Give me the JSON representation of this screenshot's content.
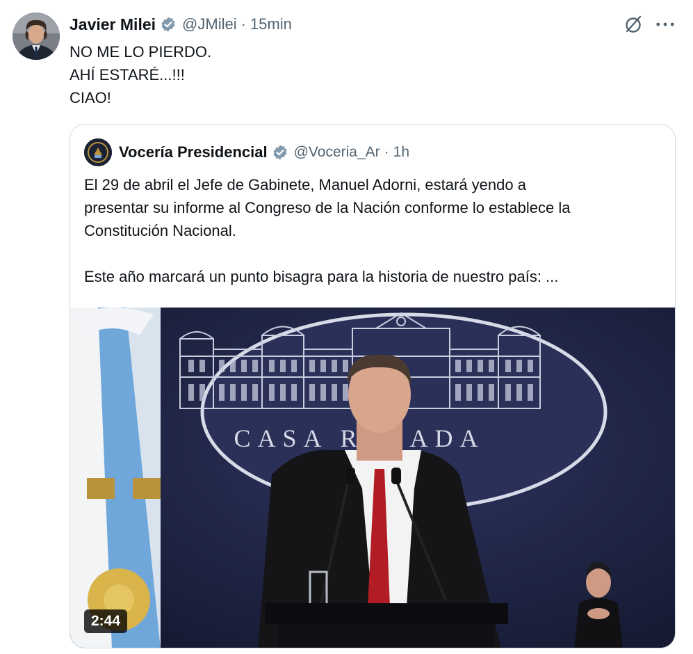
{
  "tweet": {
    "author_name": "Javier Milei",
    "author_handle": "@JMilei",
    "separator": "·",
    "time": "15min",
    "text_lines": [
      "NO ME LO PIERDO.",
      "AHÍ ESTARÉ...!!!",
      "CIAO!"
    ]
  },
  "actions": {
    "grok_icon": "grok-slash-circle-icon",
    "more_icon": "more-dots-icon"
  },
  "quoted_tweet": {
    "author_name": "Vocería Presidencial",
    "author_handle": "@Voceria_Ar",
    "separator": "·",
    "time": "1h",
    "paragraph1_lines": [
      "El 29 de abril el Jefe de Gabinete, Manuel Adorni, estará yendo a",
      "presentar su informe al Congreso de la Nación conforme lo establece la",
      "Constitución Nacional."
    ],
    "paragraph2": "Este año marcará un punto bisagra para la historia de nuestro país: ...",
    "media": {
      "backdrop_text": "CASA ROSADA",
      "duration": "2:44"
    }
  },
  "colors": {
    "verified": "#1d9bf0",
    "text_primary": "#0f1419",
    "text_secondary": "#536471",
    "border": "#cfd9de"
  }
}
